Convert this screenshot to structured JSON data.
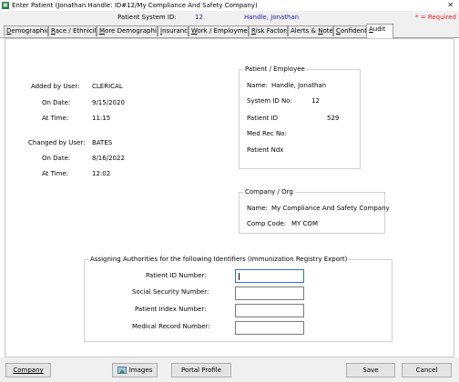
{
  "window": {
    "title": "Enter Patient (Jonathan Handle: ID#12/My Compliance And Safety Company)"
  },
  "infobar": {
    "label": "Patient System ID:",
    "id": "12",
    "name": "Handle, Jonathan",
    "required": "* = Required"
  },
  "tabs": [
    {
      "label": "Demographics",
      "underline_char": "D"
    },
    {
      "label": "Race / Ethnicity",
      "underline_char": "R"
    },
    {
      "label": "More Demographics",
      "underline_char": "M"
    },
    {
      "label": "Insurance",
      "underline_char": "I"
    },
    {
      "label": "Work / Employment",
      "underline_char": "W"
    },
    {
      "label": "Risk Factors",
      "underline_char": "R"
    },
    {
      "label": "Alerts & Notes",
      "underline_char": "N"
    },
    {
      "label": "Confidentiality",
      "underline_char": "C"
    },
    {
      "label": "Audit",
      "underline_char": "A",
      "active": true
    }
  ],
  "audit": {
    "added_by_label": "Added by User:",
    "added_by": "CLERICAL",
    "added_date_label": "On Date:",
    "added_date": "9/15/2020",
    "added_time_label": "At Time:",
    "added_time": "11:15",
    "changed_by_label": "Changed by User:",
    "changed_by": "BATES",
    "changed_date_label": "On Date:",
    "changed_date": "8/16/2022",
    "changed_time_label": "At Time:",
    "changed_time": "12:02"
  },
  "patient_group": {
    "legend": "Patient / Employee",
    "name_label": "Name:",
    "name": "Handle, Jonathan",
    "system_id_label": "System ID No:",
    "system_id": "12",
    "patient_id_label": "Patient ID",
    "patient_id": "529",
    "med_rec_label": "Med Rec No:",
    "med_rec": "",
    "patient_ndx_label": "Patient Ndx",
    "patient_ndx": ""
  },
  "company_group": {
    "legend": "Company / Org",
    "name_label": "Name:",
    "name": "My Compliance And Safety Company",
    "code_label": "Comp Code:",
    "code": "MY COM"
  },
  "authorities": {
    "legend": "Assigning Authorities for the following Identifiers (Immunization Registry Export)",
    "patient_id_label": "Patient ID Number:",
    "patient_id_value": "",
    "ssn_label": "Social Security Number:",
    "ssn_value": "",
    "patient_index_label": "Patient Index Number:",
    "patient_index_value": "",
    "medical_record_label": "Medical Record Number:",
    "medical_record_value": ""
  },
  "buttons": {
    "company": "Company",
    "images": "Images",
    "portal_profile": "Portal Profile",
    "save": "Save",
    "cancel": "Cancel"
  }
}
